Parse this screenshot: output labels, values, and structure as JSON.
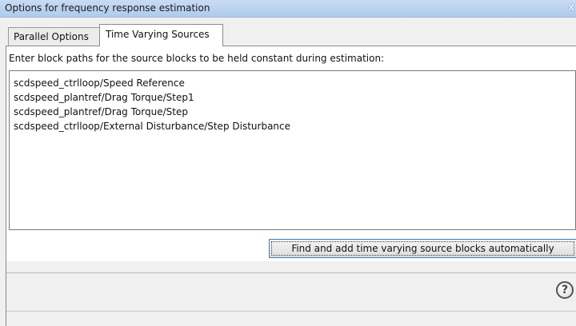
{
  "window": {
    "title": "Options for frequency response estimation",
    "close_glyph": "x"
  },
  "tabs": [
    {
      "label": "Parallel Options",
      "active": false
    },
    {
      "label": "Time Varying Sources",
      "active": true
    }
  ],
  "panel": {
    "instruction": "Enter block paths for the source blocks to be held constant during estimation:",
    "paths": [
      "scdspeed_ctrlloop/Speed Reference",
      "scdspeed_plantref/Drag Torque/Step1",
      "scdspeed_plantref/Drag Torque/Step",
      "scdspeed_ctrlloop/External Disturbance/Step Disturbance"
    ],
    "find_button_label": "Find and add time varying source blocks automatically"
  },
  "help": {
    "glyph": "?",
    "icon": "help-icon"
  },
  "colors": {
    "titlebar": "#aecbed",
    "button_border": "#3c7fb1"
  }
}
